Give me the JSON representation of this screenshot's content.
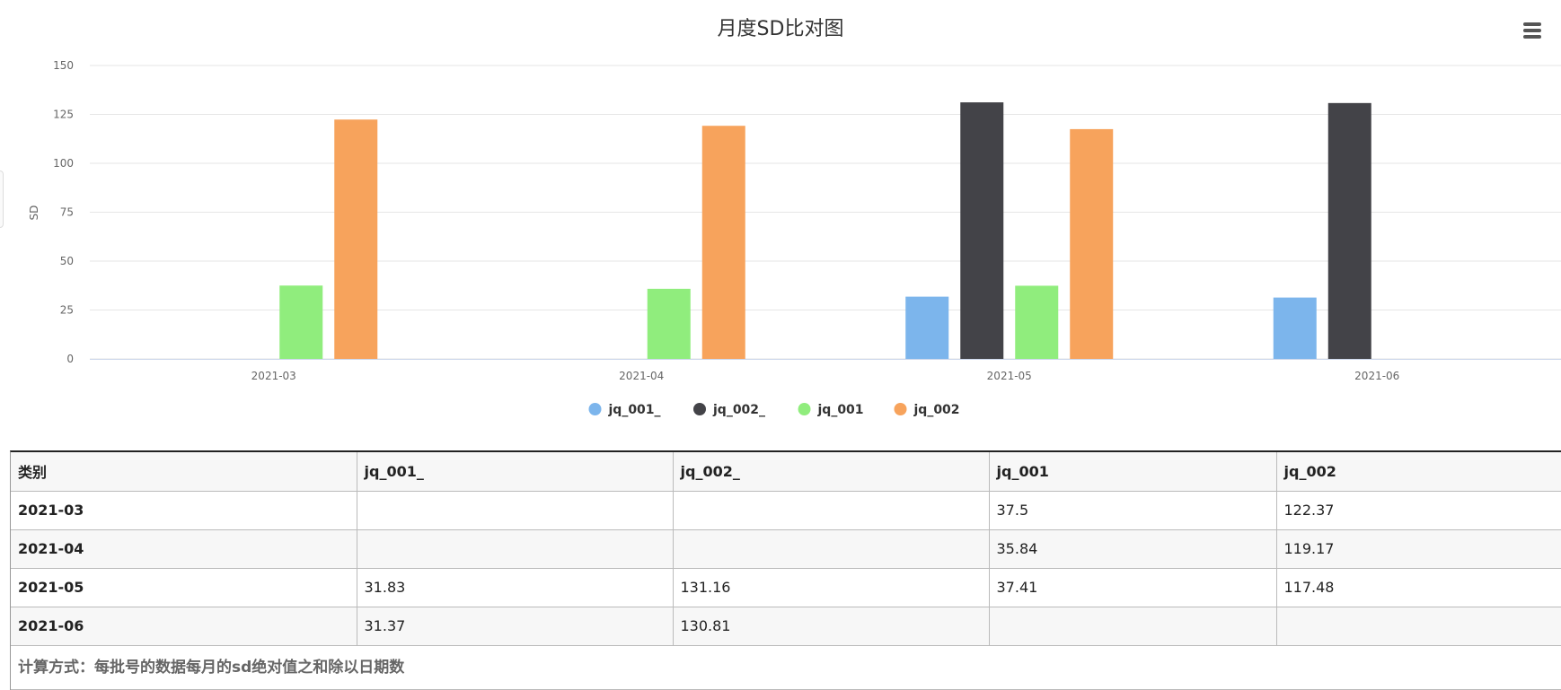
{
  "chart_data": {
    "type": "bar",
    "title": "月度SD比对图",
    "ylabel": "SD",
    "xlabel": "",
    "ylim": [
      0,
      150
    ],
    "yticks": [
      0,
      25,
      50,
      75,
      100,
      125,
      150
    ],
    "ytick_labels": [
      "0",
      "25",
      "50",
      "75",
      "100",
      "125",
      "150"
    ],
    "grid": true,
    "legend_position": "bottom-center",
    "categories": [
      "2021-03",
      "2021-04",
      "2021-05",
      "2021-06"
    ],
    "series": [
      {
        "name": "jq_001_",
        "color": "#7cb5ec",
        "values": [
          null,
          null,
          31.83,
          31.37
        ]
      },
      {
        "name": "jq_002_",
        "color": "#434348",
        "values": [
          null,
          null,
          131.16,
          130.81
        ]
      },
      {
        "name": "jq_001",
        "color": "#90ed7d",
        "values": [
          37.5,
          35.84,
          37.41,
          null
        ]
      },
      {
        "name": "jq_002",
        "color": "#f7a35c",
        "values": [
          122.37,
          119.17,
          117.48,
          null
        ]
      }
    ]
  },
  "menu_icon": "hamburger-menu-icon",
  "table": {
    "headers": [
      "类别",
      "jq_001_",
      "jq_002_",
      "jq_001",
      "jq_002"
    ],
    "rows": [
      [
        "2021-03",
        "",
        "",
        "37.5",
        "122.37"
      ],
      [
        "2021-04",
        "",
        "",
        "35.84",
        "119.17"
      ],
      [
        "2021-05",
        "31.83",
        "131.16",
        "37.41",
        "117.48"
      ],
      [
        "2021-06",
        "31.37",
        "130.81",
        "",
        ""
      ]
    ],
    "footnote": "计算方式：每批号的数据每月的sd绝对值之和除以日期数"
  }
}
